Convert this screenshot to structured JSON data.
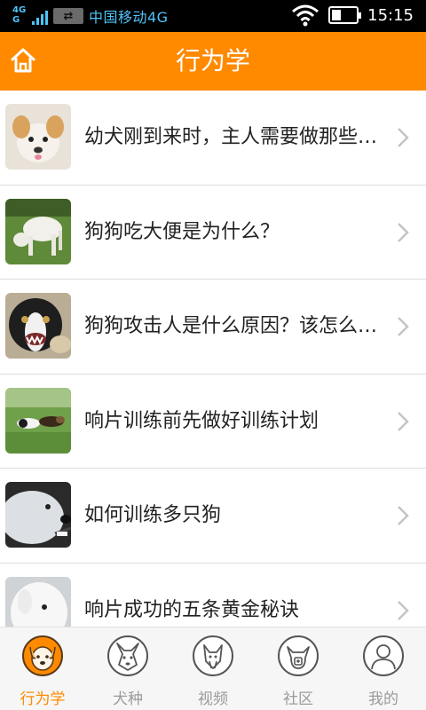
{
  "status_bar": {
    "network_type": "4G",
    "carrier": "中国移动4G",
    "time": "15:15"
  },
  "header": {
    "title": "行为学",
    "home_icon": "home-icon"
  },
  "articles": [
    {
      "title": "幼犬刚到来时，主人需要做那些准备？",
      "thumb_icon": "puppy-photo"
    },
    {
      "title": "狗狗吃大便是为什么？",
      "thumb_icon": "dog-on-grass-photo"
    },
    {
      "title": "狗狗攻击人是什么原因？该怎么办？",
      "thumb_icon": "border-collie-photo"
    },
    {
      "title": "响片训练前先做好训练计划",
      "thumb_icon": "dogs-running-photo"
    },
    {
      "title": "如何训练多只狗",
      "thumb_icon": "white-dog-photo"
    },
    {
      "title": "响片成功的五条黄金秘诀",
      "thumb_icon": "white-fluffy-dog-photo"
    }
  ],
  "tabs": [
    {
      "label": "行为学",
      "icon": "dog-face-icon",
      "active": true
    },
    {
      "label": "犬种",
      "icon": "dog-breed-icon",
      "active": false
    },
    {
      "label": "视频",
      "icon": "video-dog-icon",
      "active": false
    },
    {
      "label": "社区",
      "icon": "community-dog-icon",
      "active": false
    },
    {
      "label": "我的",
      "icon": "profile-icon",
      "active": false
    }
  ],
  "colors": {
    "accent": "#ff8a00",
    "tab_inactive": "#9a9a9a",
    "status_blue": "#4fc3f7"
  }
}
